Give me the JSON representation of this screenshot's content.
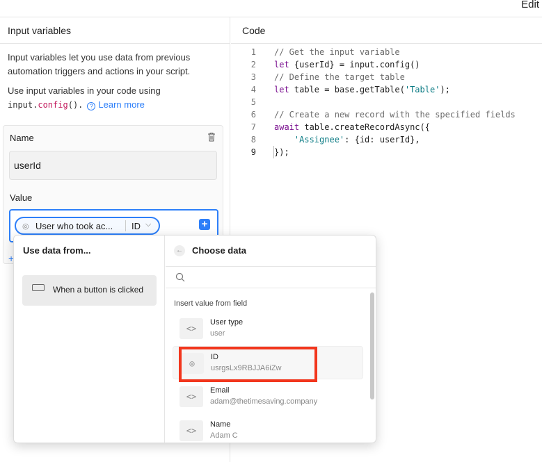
{
  "topbar": {
    "edit_label": "Edit"
  },
  "left": {
    "header": "Input variables",
    "desc1": "Input variables let you use data from previous automation triggers and actions in your script.",
    "desc2_prefix": "Use input variables in your code using",
    "code_obj": "input.",
    "code_fn": "config",
    "code_paren": "().",
    "learn_more": "Learn more",
    "name_label": "Name",
    "name_value": "userId",
    "value_label": "Value",
    "pill_text": "User who took ac...",
    "pill_id": "ID",
    "add_peek": "+"
  },
  "code": {
    "header": "Code",
    "lines": [
      {
        "n": "1",
        "parts": [
          [
            "cm",
            "// Get the input variable"
          ]
        ]
      },
      {
        "n": "2",
        "parts": [
          [
            "kw",
            "let"
          ],
          [
            "",
            " {userId} = input.config()"
          ]
        ]
      },
      {
        "n": "3",
        "parts": [
          [
            "cm",
            "// Define the target table"
          ]
        ]
      },
      {
        "n": "4",
        "parts": [
          [
            "kw",
            "let"
          ],
          [
            "",
            " table = base.getTable("
          ],
          [
            "str",
            "'Table'"
          ],
          [
            "",
            ");"
          ]
        ]
      },
      {
        "n": "5",
        "parts": [
          [
            "",
            ""
          ]
        ]
      },
      {
        "n": "6",
        "parts": [
          [
            "cm",
            "// Create a new record with the specified fields"
          ]
        ]
      },
      {
        "n": "7",
        "parts": [
          [
            "kw",
            "await"
          ],
          [
            "",
            " table.createRecordAsync({"
          ]
        ]
      },
      {
        "n": "8",
        "parts": [
          [
            "",
            "    "
          ],
          [
            "str",
            "'Assignee'"
          ],
          [
            "",
            ": {id: userId},"
          ]
        ]
      },
      {
        "n": "9",
        "parts": [
          [
            "",
            "});"
          ]
        ]
      }
    ]
  },
  "popup": {
    "left_title": "Use data from...",
    "trigger": "When a button is clicked",
    "right_title": "Choose data",
    "search_placeholder": "",
    "section": "Insert value from field",
    "fields": [
      {
        "name": "User type",
        "value": "user",
        "icon": "code-icon"
      },
      {
        "name": "ID",
        "value": "usrgsLx9RBJJA6iZw",
        "icon": "fingerprint-icon"
      },
      {
        "name": "Email",
        "value": "adam@thetimesaving.company",
        "icon": "code-icon"
      },
      {
        "name": "Name",
        "value": "Adam C",
        "icon": "code-icon"
      }
    ]
  },
  "colors": {
    "accent": "#2d7ff9",
    "highlight": "#f2361d",
    "keyword": "#7a0f8f",
    "string": "#0b7b84"
  }
}
